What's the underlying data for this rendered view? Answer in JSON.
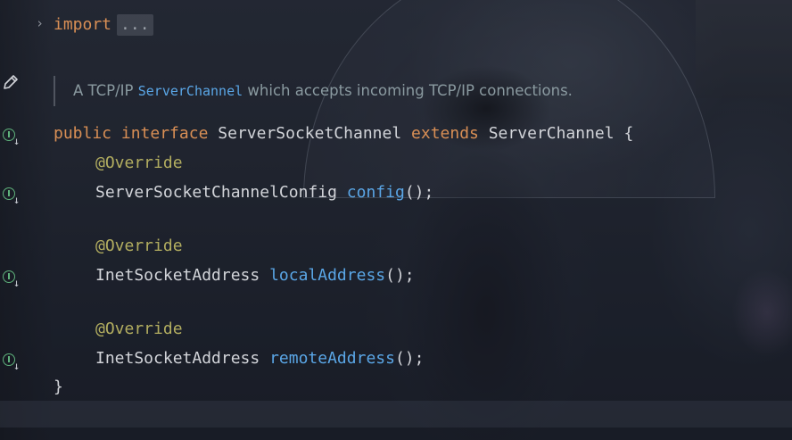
{
  "editor": {
    "import_keyword": "import",
    "import_folded": "...",
    "doc": {
      "prefix": "A TCP/IP",
      "code_ref": "ServerChannel",
      "suffix": "which accepts incoming TCP/IP connections."
    },
    "decl": {
      "kw_public": "public",
      "kw_interface": "interface",
      "name": "ServerSocketChannel",
      "kw_extends": "extends",
      "parent": "ServerChannel",
      "open_brace": "{"
    },
    "methods": [
      {
        "annotation": "@Override",
        "return_type": "ServerSocketChannelConfig",
        "name": "config",
        "tail": "();"
      },
      {
        "annotation": "@Override",
        "return_type": "InetSocketAddress",
        "name": "localAddress",
        "tail": "();"
      },
      {
        "annotation": "@Override",
        "return_type": "InetSocketAddress",
        "name": "remoteAddress",
        "tail": "();"
      }
    ],
    "close_brace": "}"
  },
  "gutter": {
    "implements_icon": "implementation-marker-icon",
    "edit_icon": "pencil-icon",
    "fold_icon": "chevron-right-icon"
  },
  "colors": {
    "keyword": "#d98f55",
    "annotation": "#b3ae60",
    "method": "#5aa6e6",
    "text": "#d2d4d9",
    "gutter_marker": "#5fb37c"
  }
}
